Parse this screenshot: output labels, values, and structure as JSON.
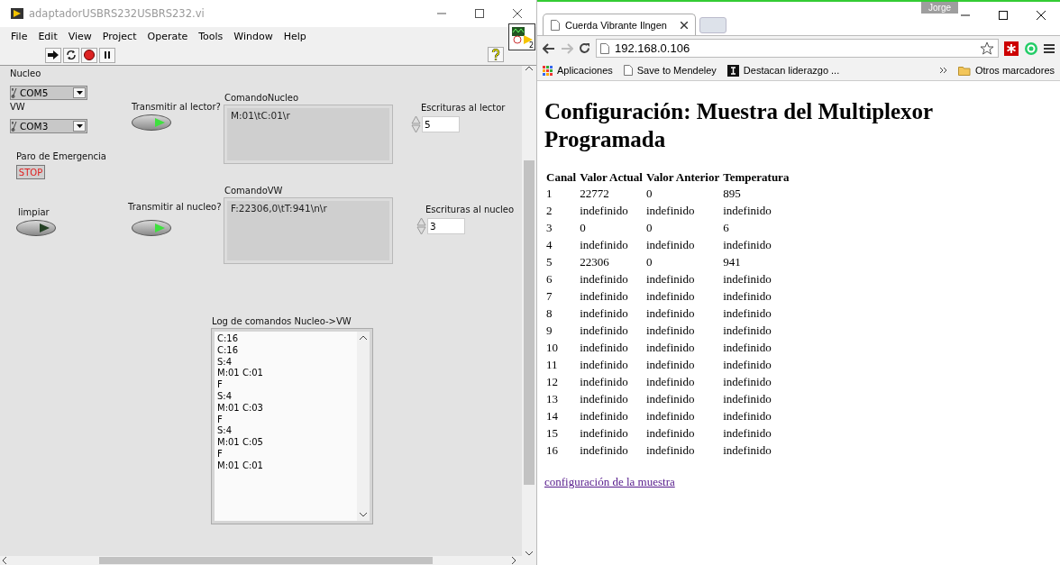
{
  "labview": {
    "title": "adaptadorUSBRS232USBRS232.vi",
    "menu": [
      "File",
      "Edit",
      "View",
      "Project",
      "Operate",
      "Tools",
      "Window",
      "Help"
    ],
    "vi_badge": "2",
    "nucleo_port": {
      "label": "Nucleo",
      "value": "COM5"
    },
    "vw_port": {
      "label": "VW",
      "value": "COM3"
    },
    "emergency": {
      "label": "Paro de Emergencia",
      "text": "STOP"
    },
    "clear": {
      "label": "limpiar",
      "on": false
    },
    "send_reader": {
      "label": "Transmitir al lector?",
      "on": true
    },
    "send_nucleo": {
      "label": "Transmitir al nucleo?",
      "on": true
    },
    "command_nucleo": {
      "label": "ComandoNucleo",
      "value": "M:01\\tC:01\\r"
    },
    "command_vw": {
      "label": "ComandoVW",
      "value": "F:22306,0\\tT:941\\n\\r"
    },
    "reader_writes": {
      "label": "Escrituras al lector",
      "value": "5"
    },
    "nucleo_writes": {
      "label": "Escrituras al nucleo",
      "value": "3"
    },
    "log": {
      "label": "Log de comandos Nucleo->VW",
      "lines": [
        "C:16",
        "C:16",
        "S:4",
        "M:01 C:01",
        "F",
        "S:4",
        "M:01 C:03",
        "F",
        "S:4",
        "M:01 C:05",
        "F",
        "M:01 C:01"
      ]
    }
  },
  "browser": {
    "profile": "Jorge",
    "tab": "Cuerda Vibrante Ilngen",
    "url": "192.168.0.106",
    "bookmarks": [
      {
        "kind": "apps",
        "label": "Aplicaciones"
      },
      {
        "kind": "page",
        "label": "Save to Mendeley"
      },
      {
        "kind": "site",
        "label": "Destacan liderazgo ..."
      }
    ],
    "other_bookmarks": "Otros marcadores",
    "heading": "Configuración: Muestra del Multiplexor Programada",
    "table": {
      "columns": [
        "Canal",
        "Valor Actual",
        "Valor Anterior",
        "Temperatura"
      ],
      "rows": [
        [
          "1",
          "22772",
          "0",
          "895"
        ],
        [
          "2",
          "indefinido",
          "indefinido",
          "indefinido"
        ],
        [
          "3",
          "0",
          "0",
          "6"
        ],
        [
          "4",
          "indefinido",
          "indefinido",
          "indefinido"
        ],
        [
          "5",
          "22306",
          "0",
          "941"
        ],
        [
          "6",
          "indefinido",
          "indefinido",
          "indefinido"
        ],
        [
          "7",
          "indefinido",
          "indefinido",
          "indefinido"
        ],
        [
          "8",
          "indefinido",
          "indefinido",
          "indefinido"
        ],
        [
          "9",
          "indefinido",
          "indefinido",
          "indefinido"
        ],
        [
          "10",
          "indefinido",
          "indefinido",
          "indefinido"
        ],
        [
          "11",
          "indefinido",
          "indefinido",
          "indefinido"
        ],
        [
          "12",
          "indefinido",
          "indefinido",
          "indefinido"
        ],
        [
          "13",
          "indefinido",
          "indefinido",
          "indefinido"
        ],
        [
          "14",
          "indefinido",
          "indefinido",
          "indefinido"
        ],
        [
          "15",
          "indefinido",
          "indefinido",
          "indefinido"
        ],
        [
          "16",
          "indefinido",
          "indefinido",
          "indefinido"
        ]
      ]
    },
    "link": "configuración de la muestra"
  }
}
